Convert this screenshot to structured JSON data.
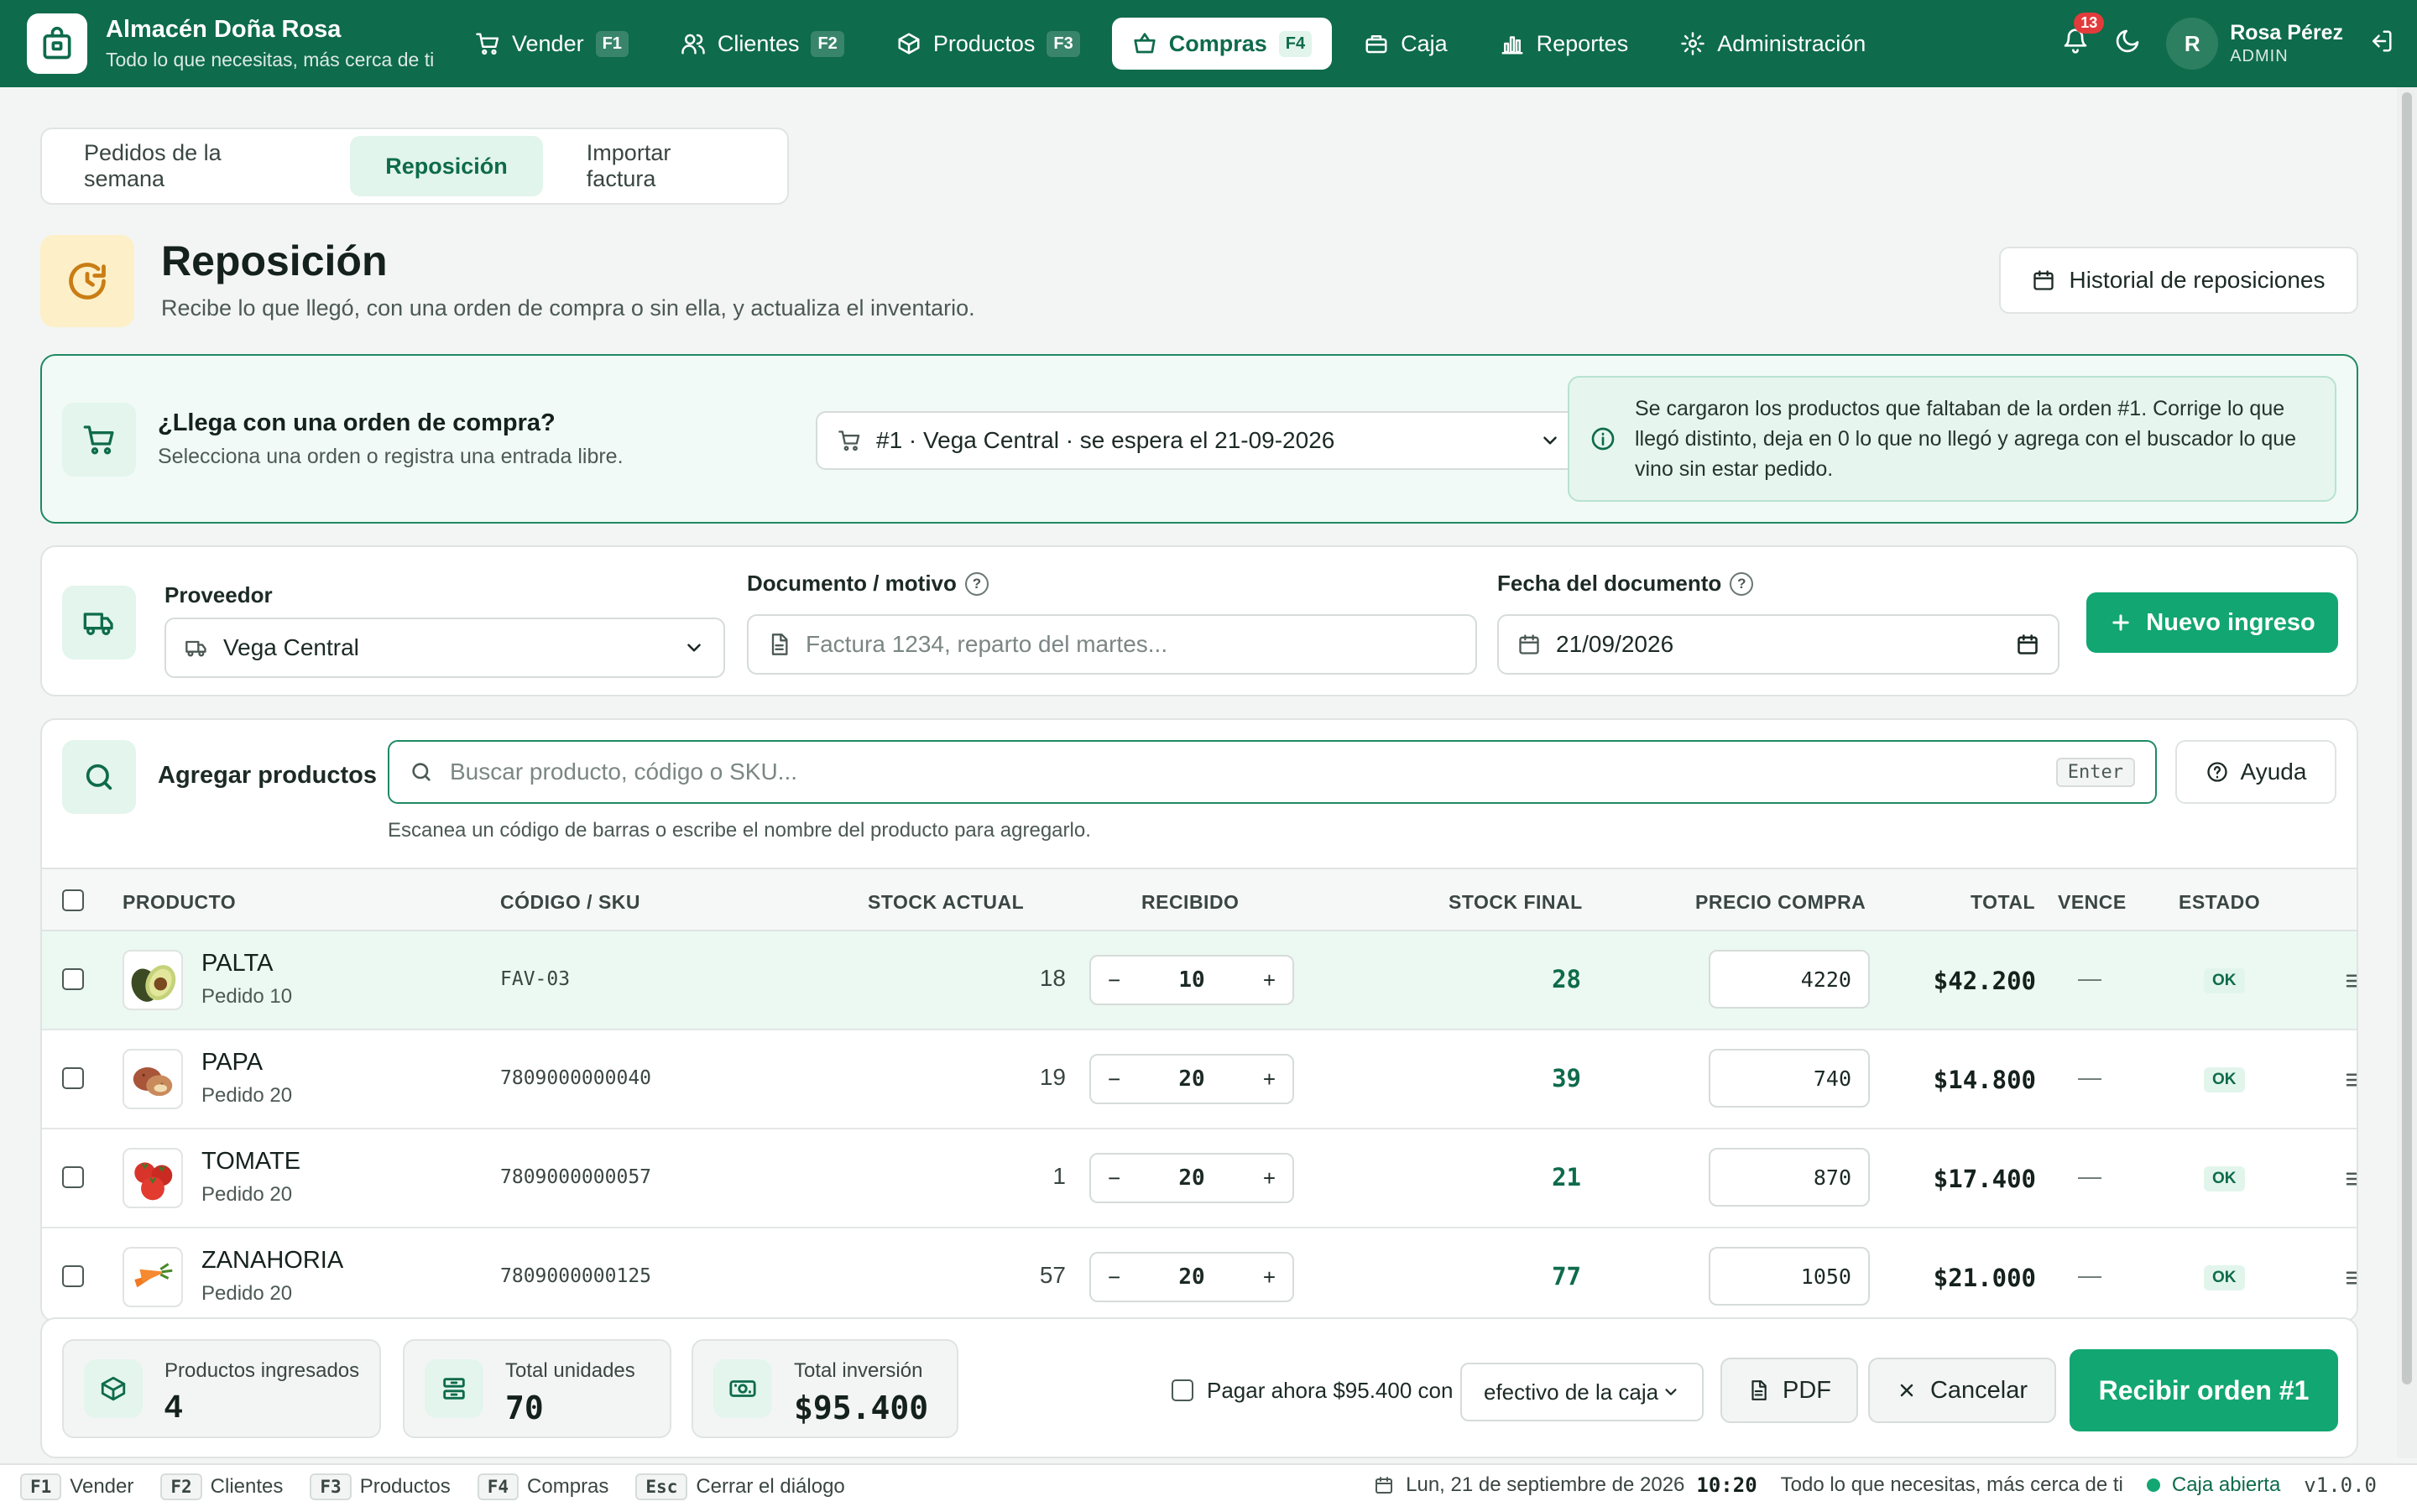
{
  "app": {
    "name": "Almacén Doña Rosa",
    "tagline": "Todo lo que necesitas, más cerca de ti"
  },
  "nav": [
    {
      "label": "Vender",
      "key": "F1",
      "icon": "cash-register-icon"
    },
    {
      "label": "Clientes",
      "key": "F2",
      "icon": "users-icon"
    },
    {
      "label": "Productos",
      "key": "F3",
      "icon": "box-icon"
    },
    {
      "label": "Compras",
      "key": "F4",
      "icon": "basket-icon",
      "active": true
    },
    {
      "label": "Caja",
      "key": "",
      "icon": "cash-box-icon"
    },
    {
      "label": "Reportes",
      "key": "",
      "icon": "bar-chart-icon"
    },
    {
      "label": "Administración",
      "key": "",
      "icon": "gear-icon"
    }
  ],
  "notifications": {
    "count": "13"
  },
  "user": {
    "initial": "R",
    "name": "Rosa Pérez",
    "role": "ADMIN"
  },
  "tabs": [
    {
      "label": "Pedidos de la semana"
    },
    {
      "label": "Reposición",
      "active": true
    },
    {
      "label": "Importar factura"
    }
  ],
  "header": {
    "title": "Reposición",
    "subtitle": "Recibe lo que llegó, con una orden de compra o sin ella, y actualiza el inventario.",
    "history_button": "Historial de reposiciones"
  },
  "order": {
    "title": "¿Llega con una orden de compra?",
    "subtitle": "Selecciona una orden o registra una entrada libre.",
    "selected": "#1 · Vega Central · se espera el 21-09-2026",
    "info": "Se cargaron los productos que faltaban de la orden #1. Corrige lo que llegó distinto, deja en 0 lo que no llegó y agrega con el buscador lo que vino sin estar pedido."
  },
  "supplier": {
    "label": "Proveedor",
    "value": "Vega Central",
    "doc_label": "Documento / motivo",
    "doc_placeholder": "Factura 1234, reparto del martes...",
    "date_label": "Fecha del documento",
    "date_value": "21/09/2026",
    "new_button": "Nuevo ingreso"
  },
  "products": {
    "add_label": "Agregar productos",
    "search_placeholder": "Buscar producto, código o SKU...",
    "search_key": "Enter",
    "help_button": "Ayuda",
    "hint": "Escanea un código de barras o escribe el nombre del producto para agregarlo.",
    "columns": {
      "product": "PRODUCTO",
      "code": "CÓDIGO / SKU",
      "stock": "STOCK ACTUAL",
      "received": "RECIBIDO",
      "final": "STOCK FINAL",
      "price": "PRECIO COMPRA",
      "total": "TOTAL",
      "expires": "VENCE",
      "state": "ESTADO"
    },
    "rows": [
      {
        "name": "PALTA",
        "order": "Pedido 10",
        "code": "FAV-03",
        "stock": "18",
        "received": "10",
        "final": "28",
        "price": "4220",
        "total": "$42.200",
        "expires": "—",
        "state": "OK",
        "icon": "avocado-icon"
      },
      {
        "name": "PAPA",
        "order": "Pedido 20",
        "code": "7809000000040",
        "stock": "19",
        "received": "20",
        "final": "39",
        "price": "740",
        "total": "$14.800",
        "expires": "—",
        "state": "OK",
        "icon": "potato-icon"
      },
      {
        "name": "TOMATE",
        "order": "Pedido 20",
        "code": "7809000000057",
        "stock": "1",
        "received": "20",
        "final": "21",
        "price": "870",
        "total": "$17.400",
        "expires": "—",
        "state": "OK",
        "icon": "tomato-icon"
      },
      {
        "name": "ZANAHORIA",
        "order": "Pedido 20",
        "code": "7809000000125",
        "stock": "57",
        "received": "20",
        "final": "77",
        "price": "1050",
        "total": "$21.000",
        "expires": "—",
        "state": "OK",
        "icon": "carrot-icon"
      }
    ]
  },
  "summary": {
    "products_label": "Productos ingresados",
    "products_value": "4",
    "units_label": "Total unidades",
    "units_value": "70",
    "investment_label": "Total inversión",
    "investment_value": "$95.400",
    "pay_label": "Pagar ahora $95.400 con",
    "pay_method": "efectivo de la caja",
    "pdf_button": "PDF",
    "cancel_button": "Cancelar",
    "receive_button": "Recibir orden #1"
  },
  "statusbar": {
    "shortcuts": [
      {
        "key": "F1",
        "label": "Vender"
      },
      {
        "key": "F2",
        "label": "Clientes"
      },
      {
        "key": "F3",
        "label": "Productos"
      },
      {
        "key": "F4",
        "label": "Compras"
      },
      {
        "key": "Esc",
        "label": "Cerrar el diálogo"
      }
    ],
    "date": "Lun, 21 de septiembre de 2026",
    "time": "10:20",
    "tagline": "Todo lo que necesitas, más cerca de ti",
    "cash_status": "Caja abierta",
    "version": "v1.0.0"
  },
  "colors": {
    "brand": "#0e6b4c",
    "accent": "#12a672",
    "alert": "#e23b3b",
    "header_icon_bg": "#fdf0c8"
  }
}
